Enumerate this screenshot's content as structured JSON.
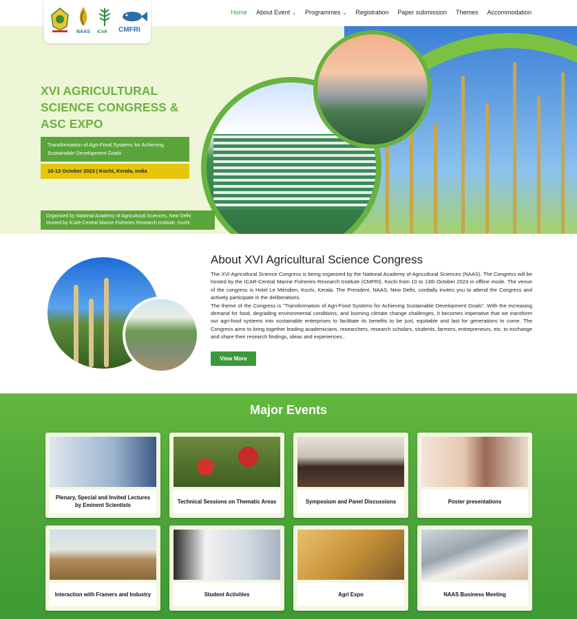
{
  "nav": {
    "items": [
      {
        "label": "Home",
        "active": true,
        "dropdown": false
      },
      {
        "label": "About Event",
        "active": false,
        "dropdown": true
      },
      {
        "label": "Programmes",
        "active": false,
        "dropdown": true
      },
      {
        "label": "Registration",
        "active": false,
        "dropdown": false
      },
      {
        "label": "Paper submission",
        "active": false,
        "dropdown": false
      },
      {
        "label": "Themes",
        "active": false,
        "dropdown": false
      },
      {
        "label": "Accommodation",
        "active": false,
        "dropdown": false
      }
    ],
    "active_color": "#3a9a3a"
  },
  "logos": {
    "naas": "NAAS",
    "icar": "ICAR",
    "cmfri": "CMFRI"
  },
  "hero": {
    "title": "XVI AGRICULTURAL SCIENCE CONGRESS & ASC EXPO",
    "theme": "Transformation of Agri-Food Systems for Achieving Sustainable Development Goals",
    "date": "10-13 October 2023 | Kochi, Kerala, India",
    "organised": "Organised by National Academy of Agricultural Sciences, New Delhi",
    "hosted": "Hosted by ICAR-Central Marine Fisheries Research Institute, Kochi",
    "title_color": "#6cb33f",
    "accent_green": "#5aa539",
    "accent_yellow": "#e5c60b"
  },
  "about": {
    "title": "About XVI Agricultural Science Congress",
    "para1": "The XVI Agricultural Science Congress is being organized by the National Academy of Agricultural Sciences (NAAS). The Congress will be hosted by the ICAR-Central Marine Fisheries Research Institute (CMFRI), Kochi from 10 to 13th October 2023 in offline mode. The venue of the congress is Hotel Le Méridien, Kochi, Kerala. The President, NAAS, New Delhi, cordially invites you to attend the Congress and actively participate in the deliberations.",
    "para2": "The theme of the Congress is \"Transformation of Agri-Food Systems for Achieving Sustainable Development Goals\". With the increasing demand for food, degrading environmental conditions, and looming climate change challenges, it becomes imperative that we transform our agri-food systems into sustainable enterprises to facilitate its benefits to be just, equitable and last for generations to come. The Congress aims to bring together leading academicians, researchers, research scholars, students, farmers, entrepreneurs, etc. to exchange and share their research findings, ideas and experiences..",
    "button": "View More"
  },
  "events": {
    "title": "Major Events",
    "cards": [
      {
        "label": "Plenary, Special and Invited Lectures by Eminent Scientists"
      },
      {
        "label": "Technical Sessions on Thematic Areas"
      },
      {
        "label": "Symposium and Panel Discussions"
      },
      {
        "label": "Poster presentations"
      },
      {
        "label": "Interaction with Framers and Industry"
      },
      {
        "label": "Student Activities"
      },
      {
        "label": "Agri Expo"
      },
      {
        "label": "NAAS Business Meeting"
      }
    ]
  }
}
